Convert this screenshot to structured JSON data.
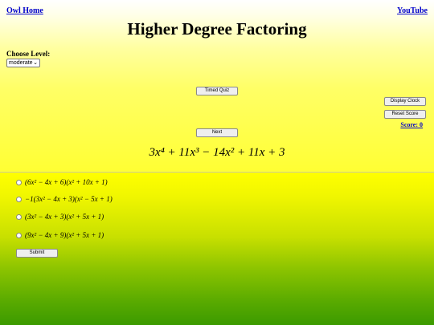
{
  "nav": {
    "home_label": "Owl Home",
    "youtube_label": "YouTube"
  },
  "page": {
    "title": "Higher Degree Factoring"
  },
  "level": {
    "label": "Choose Level:",
    "selected": "moderate"
  },
  "buttons": {
    "timed_quiz": "Timed Quiz",
    "display_clock": "Display Clock",
    "reset_score": "Reset Score",
    "next": "Next",
    "submit": "Submit"
  },
  "score": {
    "text": "Score: 0"
  },
  "problem": {
    "expression": "3x⁴ + 11x³ − 14x² + 11x + 3"
  },
  "choices": [
    "(6x² − 4x + 6)(x² + 10x + 1)",
    "−1(3x² − 4x + 3)(x² − 5x + 1)",
    "(3x² − 4x + 3)(x² + 5x + 1)",
    "(9x² − 4x + 9)(x² + 5x + 1)"
  ],
  "colors": {
    "link": "#0000cc",
    "gradient_top": "#ffffff",
    "gradient_mid": "#ffff00",
    "gradient_bottom": "#3c9a00"
  }
}
